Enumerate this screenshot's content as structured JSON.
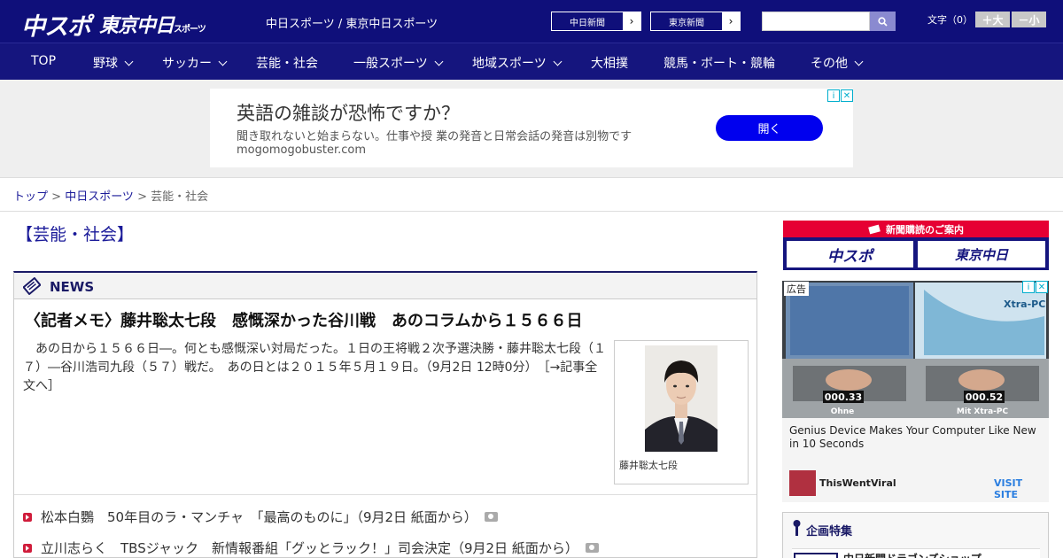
{
  "header": {
    "logo_main": "中スポ",
    "logo_tokyo": "東京中日",
    "logo_tokyo_sub": "スポーツ",
    "site_links": "中日スポーツ / 東京中日スポーツ",
    "pill1": "中日新聞",
    "pill2": "東京新聞",
    "font_label": "文字（0）",
    "font_larger": "＋大",
    "font_smaller": "－小"
  },
  "nav": {
    "items": [
      {
        "label": "TOP",
        "dropdown": false
      },
      {
        "label": "野球",
        "dropdown": true
      },
      {
        "label": "サッカー",
        "dropdown": true
      },
      {
        "label": "芸能・社会",
        "dropdown": false
      },
      {
        "label": "一般スポーツ",
        "dropdown": true
      },
      {
        "label": "地域スポーツ",
        "dropdown": true
      },
      {
        "label": "大相撲",
        "dropdown": false
      },
      {
        "label": "競馬・ボート・競輪",
        "dropdown": false
      },
      {
        "label": "その他",
        "dropdown": true
      }
    ]
  },
  "top_ad": {
    "title": "英語の雑談が恐怖ですか？",
    "desc": "聞き取れないと始まらない。仕事や授 業の発音と日常会話の発音は別物です",
    "domain": "mogomogobuster.com",
    "button": "開く"
  },
  "breadcrumb": {
    "top": "トップ",
    "sep": " > ",
    "chunichi": "中日スポーツ",
    "current": "芸能・社会"
  },
  "section": {
    "title": "【芸能・社会】"
  },
  "news": {
    "heading": "NEWS",
    "lead_title": "〈記者メモ〉藤井聡太七段　感慨深かった谷川戦　あのコラムから１５６６日",
    "lead_body": "　あの日から１５６６日―。何とも感慨深い対局だった。１日の王将戦２次予選決勝・藤井聡太七段（１７）―谷川浩司九段（５７）戦だ。　あの日とは２０１５年５月１９日。（9月2日 12時0分）",
    "lead_more": "［→記事全文へ］",
    "photo_caption": "藤井聡太七段",
    "items": [
      "松本白鸚　50年目のラ・マンチャ　「最高のものに」（9月2日 紙面から）",
      "立川志らく　TBSジャック　新情報番組「グッとラック！」司会決定（9月2日 紙面から）"
    ]
  },
  "sidebar": {
    "subscribe_head": "新聞購読のご案内",
    "subscribe_1": "中スポ",
    "subscribe_2": "東京中日",
    "ad_label": "広告",
    "ad_timer_1": "000.33",
    "ad_timer_1_sub": "Ohne",
    "ad_timer_2": "000.52",
    "ad_timer_2_sub": "Mit Xtra-PC",
    "ad_brand": "Xtra-PC",
    "ad_title": "Genius Device Makes Your Computer Like New in 10 Seconds",
    "ad_source": "ThisWentViral",
    "ad_visit": "VISIT SITE",
    "feature_title": "企画特集",
    "feature_item": "中日新聞ドラゴンズショップ"
  }
}
